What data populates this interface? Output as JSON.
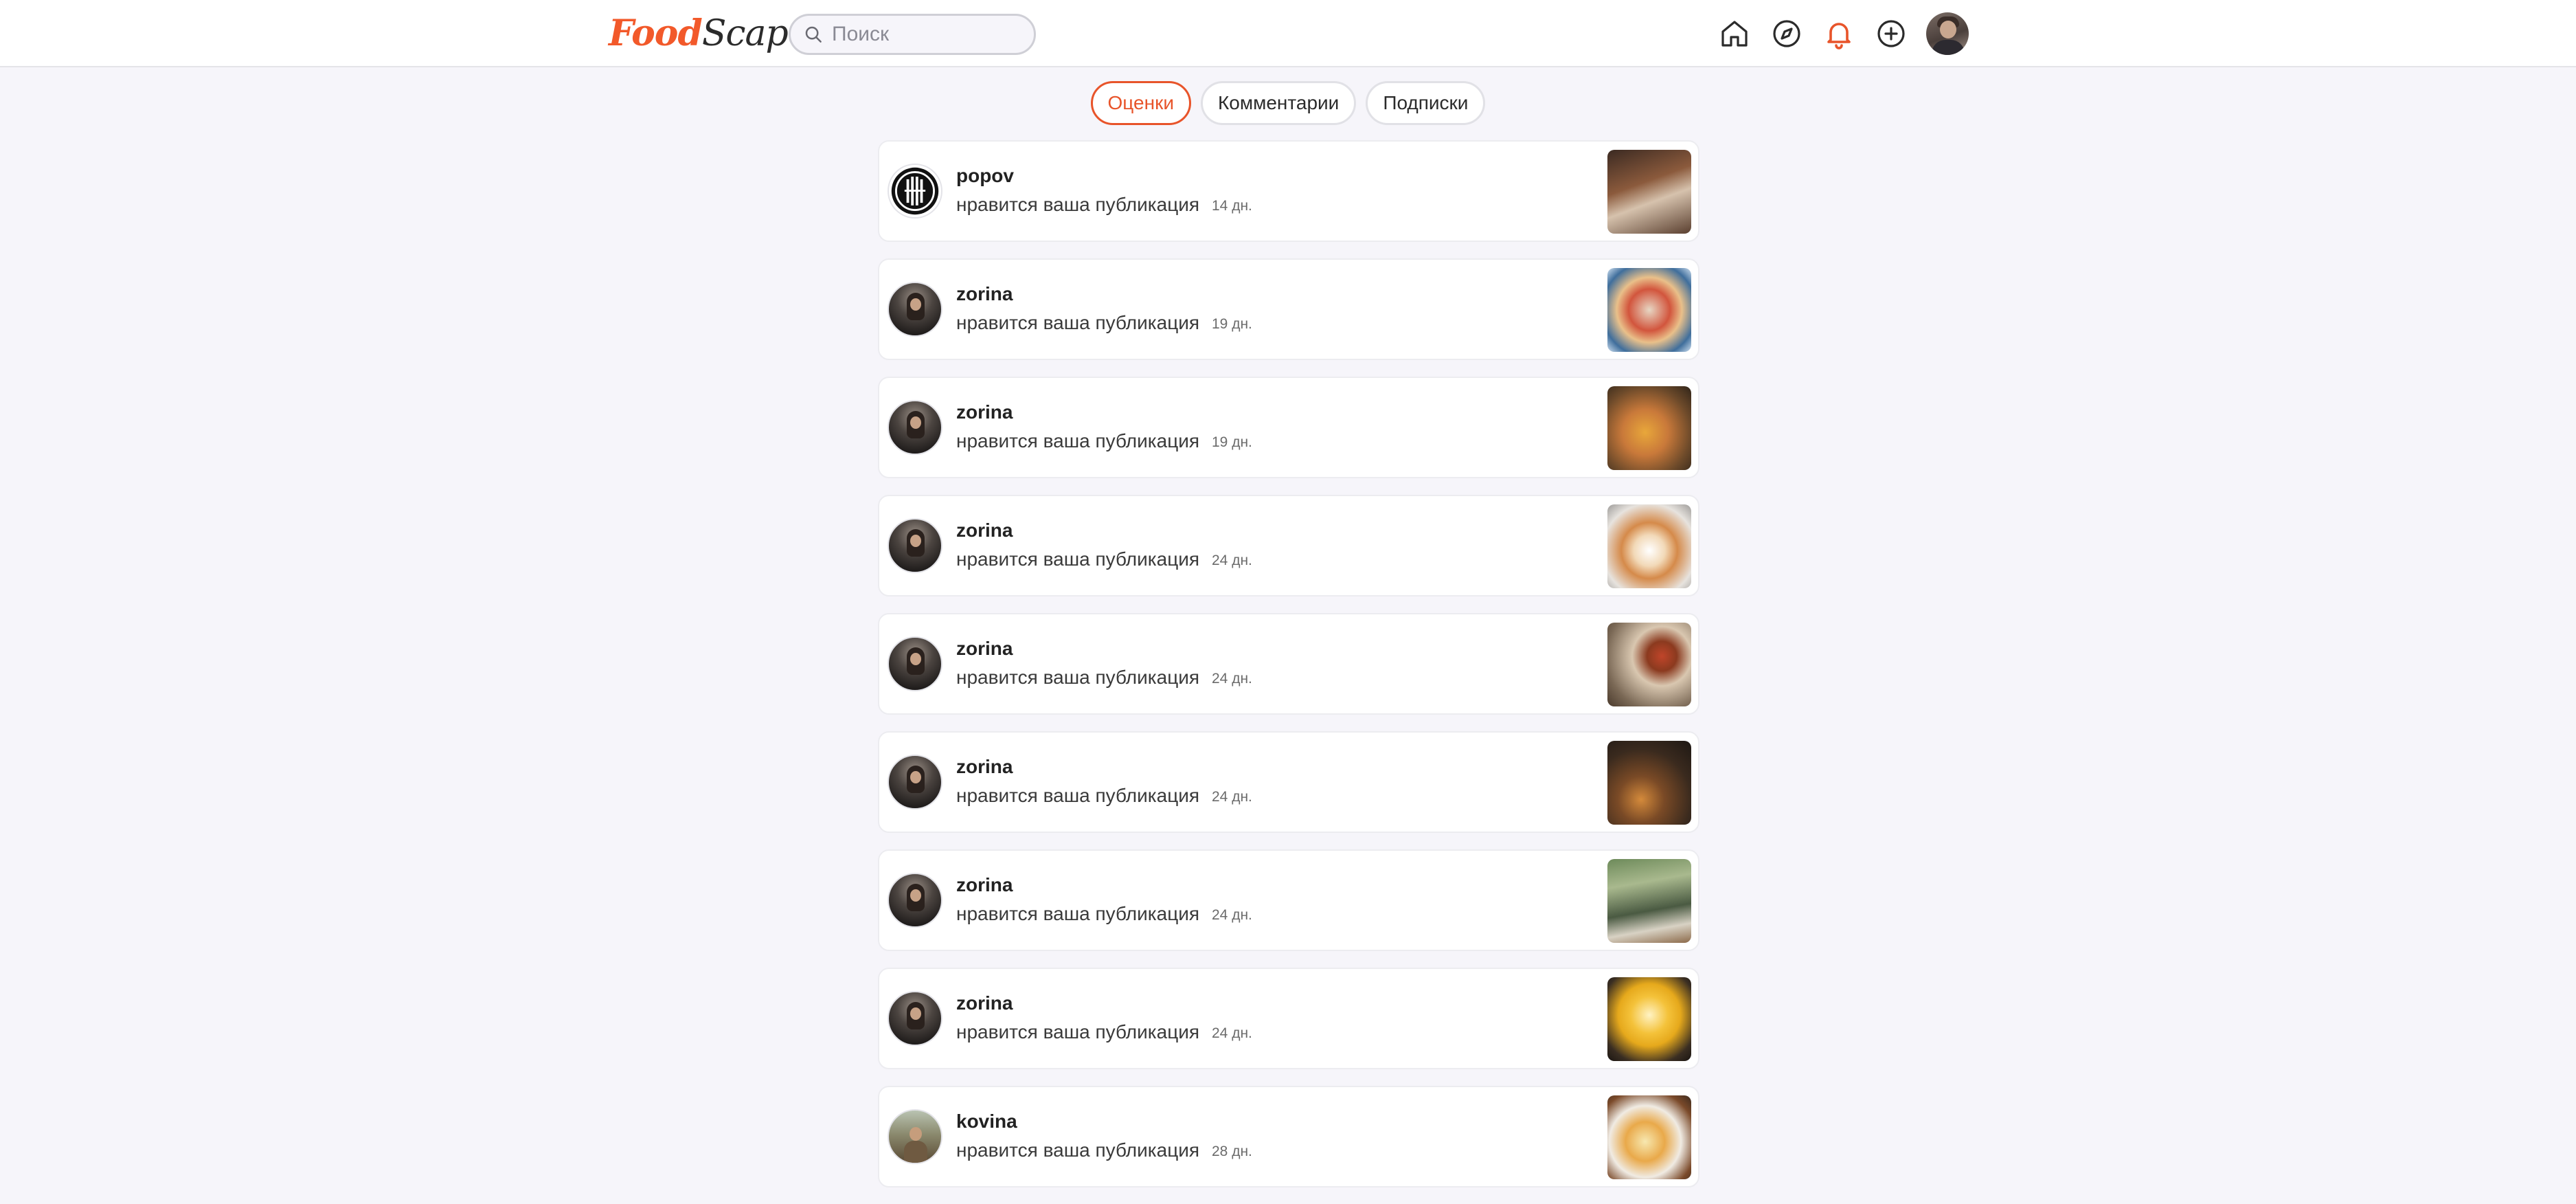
{
  "app": {
    "logo_part_a": "Food",
    "logo_part_b": "Scape"
  },
  "header": {
    "search_placeholder": "Поиск",
    "icons": [
      "home-icon",
      "explore-compass-icon",
      "notifications-bell-icon",
      "create-post-plus-icon",
      "profile-avatar"
    ]
  },
  "colors": {
    "accent": "#e8542a",
    "page_bg": "#f6f5fa",
    "card_bg": "#ffffff"
  },
  "tabs": [
    {
      "label": "Оценки",
      "active": true
    },
    {
      "label": "Комментарии",
      "active": false
    },
    {
      "label": "Подписки",
      "active": false
    }
  ],
  "notifications": [
    {
      "user": "popov",
      "action": "нравится ваша публикация",
      "time": "14 дн."
    },
    {
      "user": "zorina",
      "action": "нравится ваша публикация",
      "time": "19 дн."
    },
    {
      "user": "zorina",
      "action": "нравится ваша публикация",
      "time": "19 дн."
    },
    {
      "user": "zorina",
      "action": "нравится ваша публикация",
      "time": "24 дн."
    },
    {
      "user": "zorina",
      "action": "нравится ваша публикация",
      "time": "24 дн."
    },
    {
      "user": "zorina",
      "action": "нравится ваша публикация",
      "time": "24 дн."
    },
    {
      "user": "zorina",
      "action": "нравится ваша публикация",
      "time": "24 дн."
    },
    {
      "user": "zorina",
      "action": "нравится ваша публикация",
      "time": "24 дн."
    },
    {
      "user": "kovina",
      "action": "нравится ваша публикация",
      "time": "28 дн."
    }
  ]
}
